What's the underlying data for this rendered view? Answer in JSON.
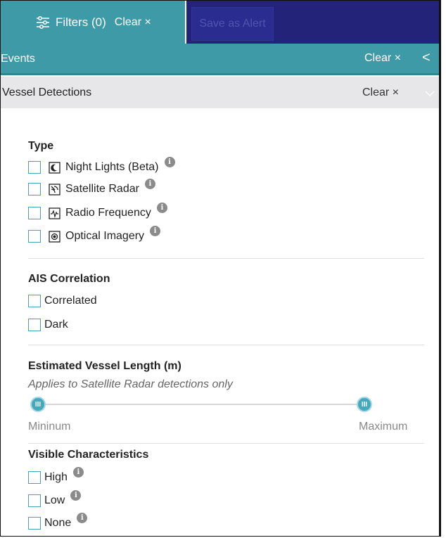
{
  "toolbar": {
    "filters_label": "Filters (0)",
    "clear_label": "Clear ×",
    "save_alert_label": "Save as Alert"
  },
  "events": {
    "label": "Events",
    "clear_label": "Clear ×",
    "chevron": "<"
  },
  "vessel": {
    "label": "Vessel Detections",
    "clear_label": "Clear ×"
  },
  "type_section": {
    "title": "Type",
    "items": [
      {
        "label": "Night Lights (Beta)",
        "icon": "night-lights-icon",
        "checked": false
      },
      {
        "label": "Satellite Radar",
        "icon": "satellite-radar-icon",
        "checked": false
      },
      {
        "label": "Radio Frequency",
        "icon": "radio-frequency-icon",
        "checked": false
      },
      {
        "label": "Optical Imagery",
        "icon": "optical-imagery-icon",
        "checked": false
      }
    ]
  },
  "ais_section": {
    "title": "AIS Correlation",
    "items": [
      {
        "label": "Correlated",
        "checked": false
      },
      {
        "label": "Dark",
        "checked": false
      }
    ]
  },
  "length_section": {
    "title": "Estimated Vessel Length (m)",
    "subtitle": "Applies to Satellite Radar detections only",
    "min_label": "Mininum",
    "max_label": "Maximum",
    "range_fraction": [
      0,
      1
    ]
  },
  "visible_section": {
    "title": "Visible Characteristics",
    "items": [
      {
        "label": "High",
        "checked": false
      },
      {
        "label": "Low",
        "checked": false
      },
      {
        "label": "None",
        "checked": false
      }
    ]
  },
  "colors": {
    "teal": "#3f9aa7",
    "navy": "#23237a",
    "checkbox_border": "#4a9fb4",
    "slider_thumb": "#45a8bd"
  }
}
